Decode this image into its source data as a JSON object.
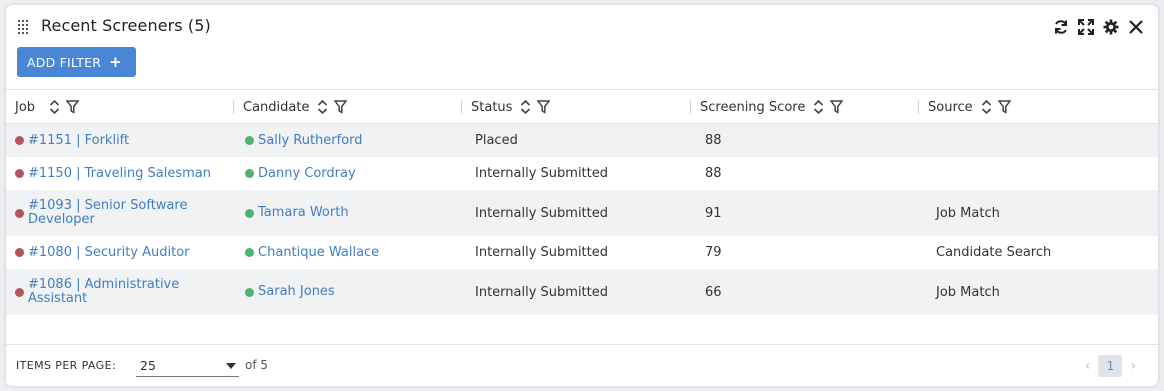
{
  "widget": {
    "title": "Recent Screeners (5)",
    "add_filter_label": "ADD FILTER",
    "actions": [
      "refresh-icon",
      "expand-icon",
      "gear-icon",
      "close-icon"
    ]
  },
  "table": {
    "columns": [
      "Job",
      "Candidate",
      "Status",
      "Screening Score",
      "Source"
    ],
    "rows": [
      {
        "job": "#1151 | Forklift",
        "candidate": "Sally Rutherford",
        "status": "Placed",
        "score": "88",
        "source": ""
      },
      {
        "job": "#1150 | Traveling Salesman",
        "candidate": "Danny Cordray",
        "status": "Internally Submitted",
        "score": "88",
        "source": ""
      },
      {
        "job": "#1093 | Senior Software Developer",
        "candidate": "Tamara Worth",
        "status": "Internally Submitted",
        "score": "91",
        "source": "Job Match"
      },
      {
        "job": "#1080 | Security Auditor",
        "candidate": "Chantique Wallace",
        "status": "Internally Submitted",
        "score": "79",
        "source": "Candidate Search"
      },
      {
        "job": "#1086 | Administrative Assistant",
        "candidate": "Sarah Jones",
        "status": "Internally Submitted",
        "score": "66",
        "source": "Job Match"
      }
    ]
  },
  "footer": {
    "items_per_page_label": "ITEMS PER PAGE:",
    "items_per_page_value": "25",
    "of_pages": "of 5",
    "current_page": "1"
  },
  "colors": {
    "accent": "#4a86d6",
    "link": "#3f7ec4",
    "job_dot": "#b4545d",
    "candidate_dot": "#4db36d"
  }
}
